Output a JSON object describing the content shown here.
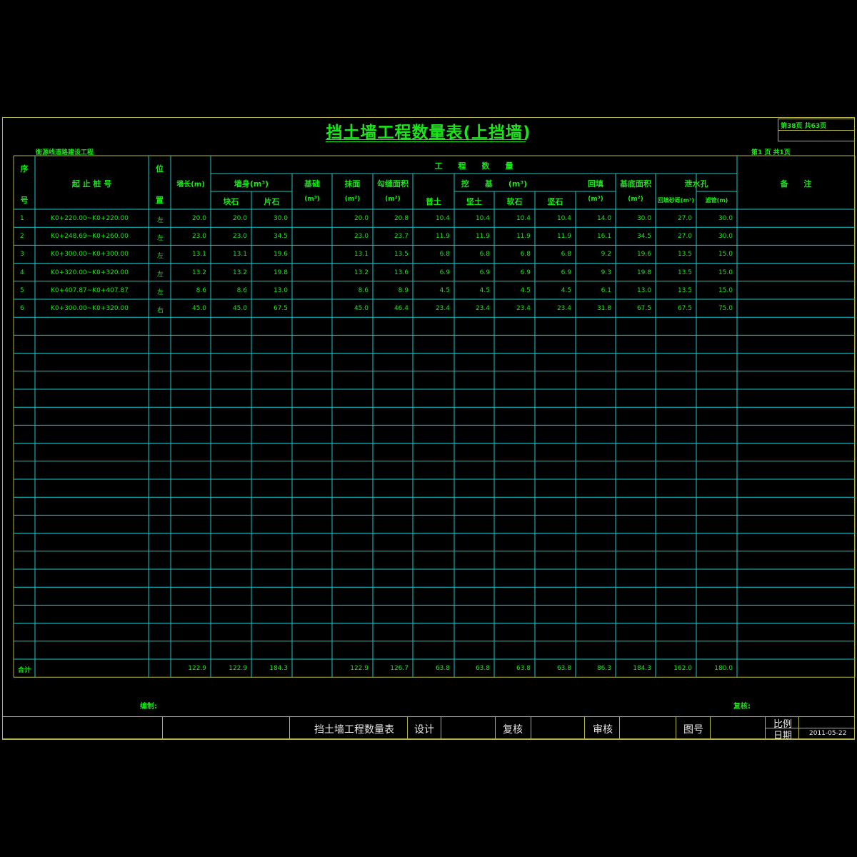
{
  "title": "挡土墙工程数量表(上挡墙)",
  "page_of_total": "第38页  共63页",
  "project_name": "衡源线道路建设工程",
  "sheet_page": "第1 页  共1页",
  "headers": {
    "seq_top": "序",
    "seq_bottom": "号",
    "station": "起 止 桩 号",
    "pos_top": "位",
    "pos_bottom": "置",
    "wall_length": "墙长(m)",
    "quantities": "工　　程　　数　　量",
    "wall_body": "墙身(m³)",
    "block_stone": "块石",
    "rubble": "片石",
    "foundation": "基础",
    "foundation_unit": "(m³)",
    "plaster": "抹面",
    "plaster_unit": "(m²)",
    "pointing": "勾缝面积",
    "pointing_unit": "(m²)",
    "excavation": "挖　　基　　(m³)",
    "normal_soil": "普土",
    "hard_soil": "坚土",
    "soft_rock": "软石",
    "hard_rock": "坚石",
    "backfill": "回填",
    "backfill_unit": "(m³)",
    "base_area": "基底面积",
    "base_area_unit": "(m²)",
    "drain": "泄水孔",
    "drain_gravel": "回填砂砾(m³)",
    "drain_pipe": "滤管(m)",
    "remarks": "备　　注"
  },
  "rows": [
    {
      "seq": "1",
      "station": "K0+220.00~K0+220.00",
      "pos": "左",
      "length": "20.0",
      "block": "20.0",
      "rubble": "30.0",
      "foundation": "",
      "plaster": "20.0",
      "pointing": "20.8",
      "ns": "10.4",
      "hs": "10.4",
      "sr": "10.4",
      "hr": "10.4",
      "backfill": "14.0",
      "base": "30.0",
      "gravel": "27.0",
      "pipe": "30.0"
    },
    {
      "seq": "2",
      "station": "K0+248.69~K0+260.00",
      "pos": "左",
      "length": "23.0",
      "block": "23.0",
      "rubble": "34.5",
      "foundation": "",
      "plaster": "23.0",
      "pointing": "23.7",
      "ns": "11.9",
      "hs": "11.9",
      "sr": "11.9",
      "hr": "11.9",
      "backfill": "16.1",
      "base": "34.5",
      "gravel": "27.0",
      "pipe": "30.0"
    },
    {
      "seq": "3",
      "station": "K0+300.00~K0+300.00",
      "pos": "左",
      "length": "13.1",
      "block": "13.1",
      "rubble": "19.6",
      "foundation": "",
      "plaster": "13.1",
      "pointing": "13.5",
      "ns": "6.8",
      "hs": "6.8",
      "sr": "6.8",
      "hr": "6.8",
      "backfill": "9.2",
      "base": "19.6",
      "gravel": "13.5",
      "pipe": "15.0"
    },
    {
      "seq": "4",
      "station": "K0+320.00~K0+320.00",
      "pos": "左",
      "length": "13.2",
      "block": "13.2",
      "rubble": "19.8",
      "foundation": "",
      "plaster": "13.2",
      "pointing": "13.6",
      "ns": "6.9",
      "hs": "6.9",
      "sr": "6.9",
      "hr": "6.9",
      "backfill": "9.3",
      "base": "19.8",
      "gravel": "13.5",
      "pipe": "15.0"
    },
    {
      "seq": "5",
      "station": "K0+407.87~K0+407.87",
      "pos": "左",
      "length": "8.6",
      "block": "8.6",
      "rubble": "13.0",
      "foundation": "",
      "plaster": "8.6",
      "pointing": "8.9",
      "ns": "4.5",
      "hs": "4.5",
      "sr": "4.5",
      "hr": "4.5",
      "backfill": "6.1",
      "base": "13.0",
      "gravel": "13.5",
      "pipe": "15.0"
    },
    {
      "seq": "6",
      "station": "K0+300.00~K0+320.00",
      "pos": "右",
      "length": "45.0",
      "block": "45.0",
      "rubble": "67.5",
      "foundation": "",
      "plaster": "45.0",
      "pointing": "46.4",
      "ns": "23.4",
      "hs": "23.4",
      "sr": "23.4",
      "hr": "23.4",
      "backfill": "31.8",
      "base": "67.5",
      "gravel": "67.5",
      "pipe": "75.0"
    }
  ],
  "total": {
    "label": "合计",
    "length": "122.9",
    "block": "122.9",
    "rubble": "184.3",
    "plaster": "122.9",
    "pointing": "126.7",
    "ns": "63.8",
    "hs": "63.8",
    "sr": "63.8",
    "hr": "63.8",
    "backfill": "86.3",
    "base": "184.3",
    "gravel": "162.0",
    "pipe": "180.0"
  },
  "compiled_by": "编制:",
  "reviewed_by": "复核:",
  "footer": {
    "table_name": "挡土墙工程数量表",
    "design": "设计",
    "check": "复核",
    "audit": "审核",
    "drawing_no": "图号",
    "scale": "比例",
    "date_label": "日期",
    "date": "2011-05-22"
  },
  "colors": {
    "line": "#19c8c8",
    "frame": "#b4b44a",
    "text": "#19e619",
    "background": "#000000"
  }
}
